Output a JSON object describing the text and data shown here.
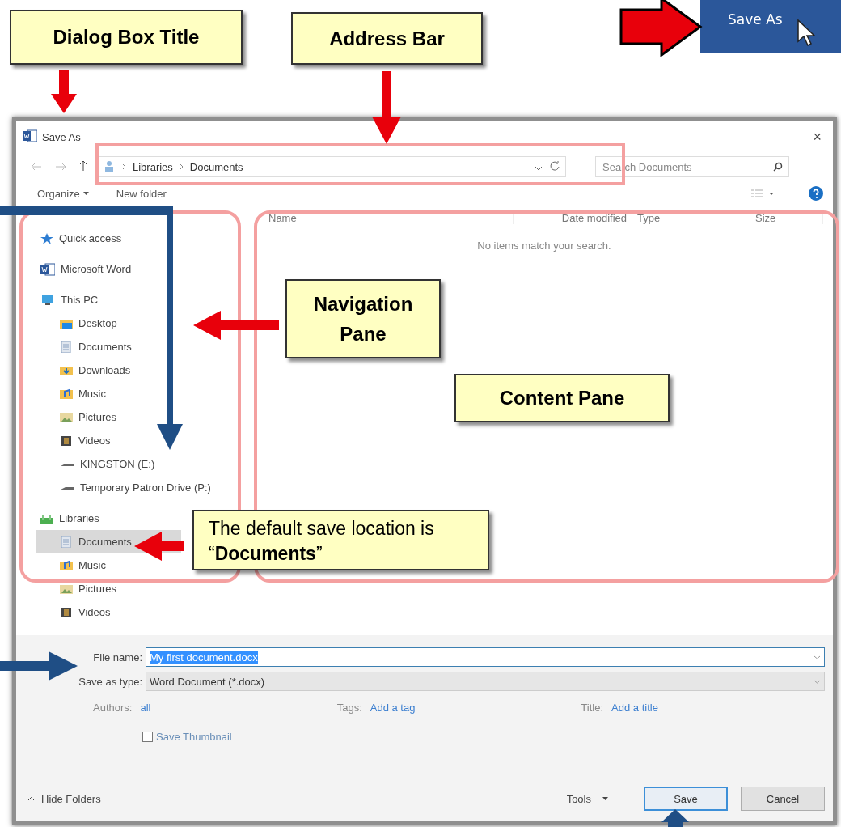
{
  "ribbon_button": {
    "label": "Save As"
  },
  "callouts": [
    {
      "kind": "title",
      "text": "Dialog Box Title"
    },
    {
      "kind": "address",
      "text": "Address Bar"
    },
    {
      "kind": "nav",
      "text": "Navigation Pane"
    },
    {
      "kind": "content",
      "text": "Content Pane"
    },
    {
      "kind": "default",
      "text": "The default save location is “**Documents**”"
    }
  ],
  "dialog": {
    "title": "Save As",
    "close": "×",
    "address": {
      "path": [
        "Libraries",
        "Documents"
      ]
    },
    "search": {
      "placeholder": "Search Documents"
    },
    "toolbar": {
      "organize": "Organize",
      "new_folder": "New folder"
    },
    "navigation": [
      {
        "label": "Quick access",
        "kind": "star",
        "selected": false
      },
      {
        "label": "Microsoft Word",
        "kind": "word",
        "selected": false
      },
      {
        "label": "This PC",
        "kind": "pc",
        "selected": false,
        "children": [
          {
            "label": "Desktop",
            "kind": "desktop",
            "selected": false
          },
          {
            "label": "Documents",
            "kind": "documents",
            "selected": false
          },
          {
            "label": "Downloads",
            "kind": "downloads",
            "selected": false
          },
          {
            "label": "Music",
            "kind": "music",
            "selected": false
          },
          {
            "label": "Pictures",
            "kind": "pictures",
            "selected": false
          },
          {
            "label": "Videos",
            "kind": "videos",
            "selected": false
          },
          {
            "label": "KINGSTON (E:)",
            "kind": "drive",
            "selected": false
          },
          {
            "label": "Temporary Patron Drive (P:)",
            "kind": "drive",
            "selected": false
          }
        ]
      },
      {
        "label": "Libraries",
        "kind": "library",
        "selected": false,
        "children": [
          {
            "label": "Documents",
            "kind": "documents",
            "selected": true
          },
          {
            "label": "Music",
            "kind": "music",
            "selected": false
          },
          {
            "label": "Pictures",
            "kind": "pictures",
            "selected": false
          },
          {
            "label": "Videos",
            "kind": "videos",
            "selected": false
          }
        ]
      }
    ],
    "columns": [
      "Name",
      "Date modified",
      "Type",
      "Size"
    ],
    "empty_message": "No items match your search.",
    "file_name": {
      "label": "File name:",
      "value": "My first document.docx",
      "selected": true
    },
    "save_as_type": {
      "label": "Save as type:",
      "value": "Word Document (*.docx)"
    },
    "metadata": [
      {
        "label": "Authors:",
        "value": "all"
      },
      {
        "label": "Tags:",
        "value": "Add a tag"
      },
      {
        "label": "Title:",
        "value": "Add a title"
      }
    ],
    "save_thumbnail": {
      "label": "Save Thumbnail",
      "checked": false
    },
    "hide_folders": "Hide Folders",
    "tools": "Tools",
    "buttons": [
      {
        "label": "Save",
        "kind": "default"
      },
      {
        "label": "Cancel",
        "kind": "normal"
      }
    ]
  }
}
